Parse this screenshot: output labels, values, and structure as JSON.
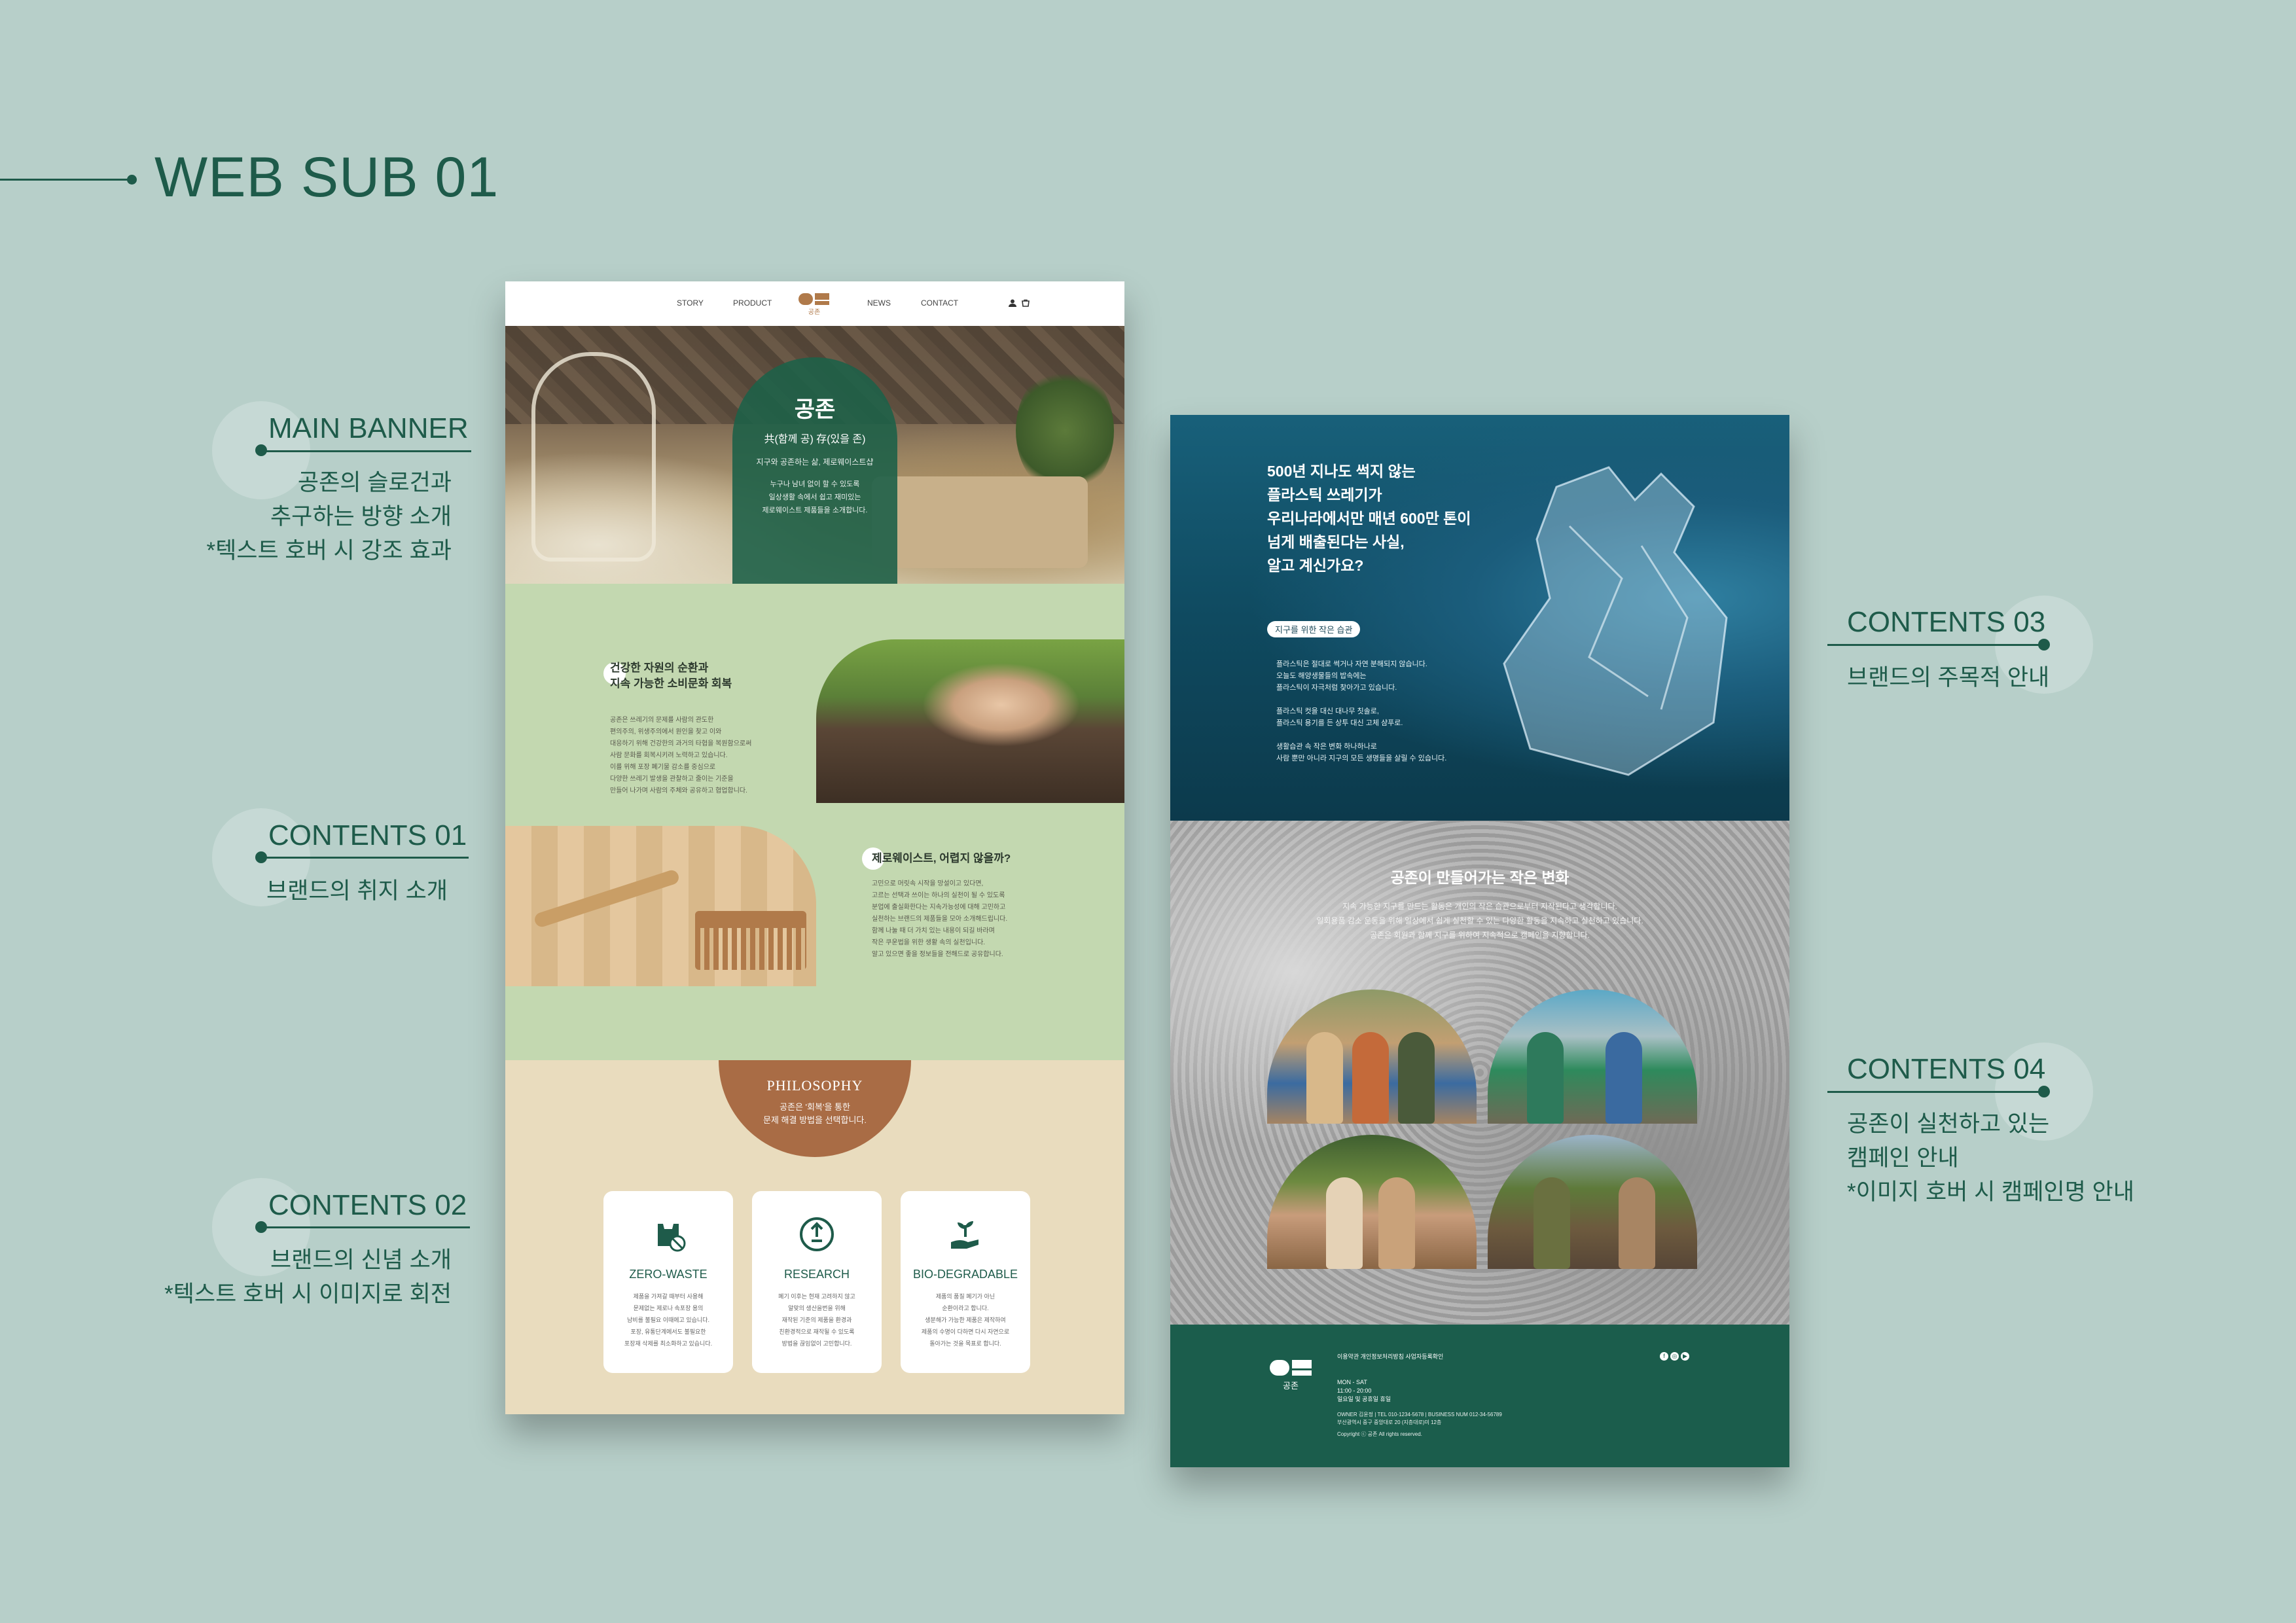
{
  "page": {
    "heading": "WEB SUB 01",
    "colors": {
      "background": "#b7cfc9",
      "brand_green": "#1e5b4a",
      "sage": "#c3d8b0",
      "beige": "#e9dcbe",
      "terracotta": "#a96c45",
      "ocean": "#0f4a60"
    }
  },
  "annotations": [
    {
      "title": "MAIN BANNER",
      "desc": "공존의 슬로건과\n추구하는 방향 소개\n*텍스트 호버 시 강조 효과"
    },
    {
      "title": "CONTENTS 01",
      "desc": "브랜드의 취지 소개"
    },
    {
      "title": "CONTENTS 02",
      "desc": "브랜드의 신념 소개\n*텍스트 호버 시 이미지로 회전"
    },
    {
      "title": "CONTENTS 03",
      "desc": "브랜드의 주목적 안내"
    },
    {
      "title": "CONTENTS 04",
      "desc": "공존이 실천하고 있는\n캠페인 안내\n*이미지 호버 시 캠페인명 안내"
    }
  ],
  "nav": {
    "items": [
      "STORY",
      "PRODUCT",
      "NEWS",
      "CONTACT"
    ],
    "logo_text": "공존",
    "icons": [
      "user-icon",
      "cart-icon"
    ]
  },
  "banner": {
    "title": "공존",
    "subtitle": "共(함께 공) 存(있을 존)",
    "line1": "지구와 공존하는 삶, 제로웨이스트샵",
    "paragraph": "누구나 남녀 없이 할 수 있도록\n일상생활 속에서 쉽고 재미있는\n제로웨이스트 제품들을 소개합니다."
  },
  "contents01": {
    "title": "건강한 자원의 순환과\n지속 가능한 소비문화 회복",
    "text": "공존은 쓰레기의 문제를 사람의 관도한\n편의주의, 위생주의에서 원인을 찾고 이와\n대응하기 위해 건강한의 과거의 타협을 복원함으로써\n사람 문화를 회복시키려 노력하고 있습니다.\n이를 위해 포장 폐기물 감소를 중심으로\n다양한 쓰레기 발생을 관찰하고 줄이는 기준을\n만들어 나가며 사람의 주체와 공유하고 협업합니다."
  },
  "contents01b": {
    "title": "제로웨이스트, 어렵지 않을까?",
    "text": "고민으로 머릿속 시작을 망설이고 있다면,\n고르는 선택과 쓰이는 하나의 실천이 될 수 있도록\n분업에 출실화한다는 지속가능성에 대해 고민하고\n실천하는 브랜드의 제품들을 모아 소개해드립니다.\n함께 나눌 때 더 가치 있는 내용이 되길 바라며\n작은 쿠운법을 위한 생활 속의 실천입니다.\n알고 있으면 좋을 정보들을 전해드로 공유합니다."
  },
  "philosophy": {
    "title": "PHILOSOPHY",
    "text": "공존은 '회복'을 통한\n문제 해결 방법을 선택합니다."
  },
  "cards": [
    {
      "icon": "no-plastic-bag-icon",
      "title": "ZERO-WASTE",
      "text": "제품을 가져갈 때부터 사용해\n문제없는 제로나 속포장 용의\n남비를 불필요 이때에고 있습니다.\n포장, 유통단계에서도 불필요한\n포장재 삭제를 최소화하고 있습니다."
    },
    {
      "icon": "recycle-icon",
      "title": "RESEARCH",
      "text": "폐기 이후는 현재 고려하지 않고\n알맞의 생산을번을 위해\n재작된 기준의 제품을 환경과\n친환경적으로 재작될 수 있도록\n방법을 끊임없이 고민합니다."
    },
    {
      "icon": "plant-hand-icon",
      "title": "BIO-DEGRADABLE",
      "text": "제품의 품질 폐기가 아닌\n순환이라고 합니다.\n생분해가 가능한 제품은 제작하여\n제품의 수명이 다하면 다시 자연으로\n돌아가는 것을 목표로 합니다."
    }
  ],
  "contents03": {
    "title": "500년 지나도 썩지 않는\n플라스틱 쓰레기가\n우리나라에서만 매년 600만 톤이\n넘게 배출된다는 사실,\n알고 계신가요?",
    "pill": "지구를 위한 작은 습관",
    "text": "플라스틱은 절대로 썩거나 자연 분해되지 않습니다.\n오늘도 해양생물들의 밥속에는\n플라스틱이 자극처럼 찾아가고 있습니다.\n\n플라스틱 컷을 대신 대나무 칫솔로,\n플라스틱 용기를 든 상투 대신 고체 샴푸로.\n\n생활습관 속 작은 변화 하나하나로\n사람 뿐만 아니라 지구의 모든 생명들을 살릴 수 있습니다."
  },
  "contents04": {
    "title": "공존이 만들어가는 작은 변화",
    "text": "지속 가능한 지구를 만드는 활동은 개인의 작은 습관으로부터 지작된다고 생각합니다.\n일회용품 감소 운동을 위해 일상에서 쉽게 실천할 수 있는 다양한 활동을 지속하고 실천하고 있습니다.\n공존은 회원과 함께 지구를 위하여 지속적으로 캠페인을 지향합니다."
  },
  "footer": {
    "links": "이용약관 개인정보처리방침 사업자등록확인",
    "hours": "MON - SAT\n11:00 - 20:00\n일요일 및 공휴일 휴일",
    "info": "OWNER 김윤정 | TEL 010-1234-5678 | BUSINESS NUM 012-34-56789\n부산광역시 중구 중앙대로 20 (지층대로)미 12층",
    "copyright": "Copyright ⓒ 공존 All rights reserved.",
    "sns": [
      "f",
      "◎",
      "▶"
    ]
  }
}
